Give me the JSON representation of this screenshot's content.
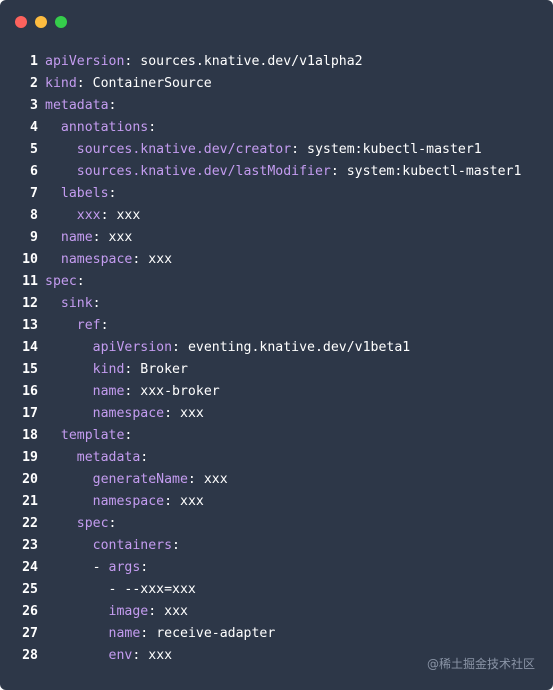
{
  "window": {
    "controls": [
      "close",
      "minimize",
      "maximize"
    ],
    "colors": {
      "close": "#fc625d",
      "minimize": "#fdbc40",
      "maximize": "#35cd4b",
      "background": "#2d3748",
      "key": "#c49cf0",
      "value": "#ffffff"
    }
  },
  "lines": [
    {
      "num": "1",
      "indent": "",
      "key": "apiVersion",
      "sep": ": ",
      "value": "sources.knative.dev/v1alpha2"
    },
    {
      "num": "2",
      "indent": "",
      "key": "kind",
      "sep": ": ",
      "value": "ContainerSource"
    },
    {
      "num": "3",
      "indent": "",
      "key": "metadata",
      "sep": ":",
      "value": ""
    },
    {
      "num": "4",
      "indent": "  ",
      "key": "annotations",
      "sep": ":",
      "value": ""
    },
    {
      "num": "5",
      "indent": "    ",
      "key": "sources.knative.dev/creator",
      "sep": ": ",
      "value": "system:kubectl-master1"
    },
    {
      "num": "6",
      "indent": "    ",
      "key": "sources.knative.dev/lastModifier",
      "sep": ": ",
      "value": "system:kubectl-master1"
    },
    {
      "num": "7",
      "indent": "  ",
      "key": "labels",
      "sep": ":",
      "value": ""
    },
    {
      "num": "8",
      "indent": "    ",
      "key": "xxx",
      "sep": ": ",
      "value": "xxx"
    },
    {
      "num": "9",
      "indent": "  ",
      "key": "name",
      "sep": ": ",
      "value": "xxx"
    },
    {
      "num": "10",
      "indent": "  ",
      "key": "namespace",
      "sep": ": ",
      "value": "xxx"
    },
    {
      "num": "11",
      "indent": "",
      "key": "spec",
      "sep": ":",
      "value": ""
    },
    {
      "num": "12",
      "indent": "  ",
      "key": "sink",
      "sep": ":",
      "value": ""
    },
    {
      "num": "13",
      "indent": "    ",
      "key": "ref",
      "sep": ":",
      "value": ""
    },
    {
      "num": "14",
      "indent": "      ",
      "key": "apiVersion",
      "sep": ": ",
      "value": "eventing.knative.dev/v1beta1"
    },
    {
      "num": "15",
      "indent": "      ",
      "key": "kind",
      "sep": ": ",
      "value": "Broker"
    },
    {
      "num": "16",
      "indent": "      ",
      "key": "name",
      "sep": ": ",
      "value": "xxx-broker"
    },
    {
      "num": "17",
      "indent": "      ",
      "key": "namespace",
      "sep": ": ",
      "value": "xxx"
    },
    {
      "num": "18",
      "indent": "  ",
      "key": "template",
      "sep": ":",
      "value": ""
    },
    {
      "num": "19",
      "indent": "    ",
      "key": "metadata",
      "sep": ":",
      "value": ""
    },
    {
      "num": "20",
      "indent": "      ",
      "key": "generateName",
      "sep": ": ",
      "value": "xxx"
    },
    {
      "num": "21",
      "indent": "      ",
      "key": "namespace",
      "sep": ": ",
      "value": "xxx"
    },
    {
      "num": "22",
      "indent": "    ",
      "key": "spec",
      "sep": ":",
      "value": ""
    },
    {
      "num": "23",
      "indent": "      ",
      "key": "containers",
      "sep": ":",
      "value": ""
    },
    {
      "num": "24",
      "indent": "      - ",
      "key": "args",
      "sep": ":",
      "value": ""
    },
    {
      "num": "25",
      "indent": "        ",
      "key": "",
      "sep": "",
      "value": "- --xxx=xxx"
    },
    {
      "num": "26",
      "indent": "        ",
      "key": "image",
      "sep": ": ",
      "value": "xxx"
    },
    {
      "num": "27",
      "indent": "        ",
      "key": "name",
      "sep": ": ",
      "value": "receive-adapter"
    },
    {
      "num": "28",
      "indent": "        ",
      "key": "env",
      "sep": ": ",
      "value": "xxx"
    }
  ],
  "watermark": "@稀土掘金技术社区"
}
